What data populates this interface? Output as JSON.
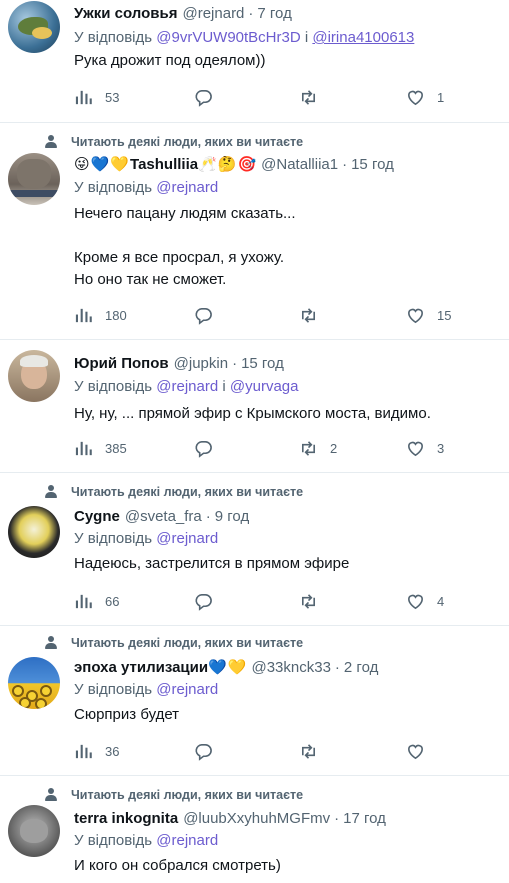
{
  "labels": {
    "replying_to": "У відповідь",
    "and": "і",
    "followed_by_context": "Читають деякі люди, яких ви читаєте"
  },
  "tweets": [
    {
      "name": "Ужки соловья",
      "handle": "@rejnard",
      "time": "7 год",
      "reply_to": [
        "@9vrVUW90tBcHr3D",
        "@irina4100613"
      ],
      "text": "Рука дрожит под одеялом))",
      "views": "53",
      "replies": "",
      "retweets": "",
      "likes": "1"
    },
    {
      "name": "Tashulliia",
      "emoji_before": [
        "😜",
        "💙",
        "💛"
      ],
      "emoji_after": [
        "🥂",
        "🤔",
        "🎯"
      ],
      "handle": "@Natalliia1",
      "time": "15 год",
      "reply_to": [
        "@rejnard"
      ],
      "text": "Нечего  пацану людям сказать...\n\nКроме я все просрал, я ухожу.\nНо оно так не сможет.",
      "views": "180",
      "replies": "",
      "retweets": "",
      "likes": "15"
    },
    {
      "name": "Юрий Попов",
      "handle": "@jupkin",
      "time": "15 год",
      "reply_to": [
        "@rejnard",
        "@yurvaga"
      ],
      "text": "Ну, ну,    ... прямой эфир с Крымского моста, видимо.",
      "views": "385",
      "replies": "",
      "retweets": "2",
      "likes": "3"
    },
    {
      "name": "Cygne",
      "handle": "@sveta_fra",
      "time": "9 год",
      "reply_to": [
        "@rejnard"
      ],
      "text": "Надеюсь, застрелится в прямом эфире",
      "views": "66",
      "replies": "",
      "retweets": "",
      "likes": "4"
    },
    {
      "name": "эпоха утилизации",
      "emoji_after": [
        "💙",
        "💛"
      ],
      "handle": "@33knck33",
      "time": "2 год",
      "reply_to": [
        "@rejnard"
      ],
      "text": "Сюрприз будет",
      "views": "36",
      "replies": "",
      "retweets": "",
      "likes": ""
    },
    {
      "name": "terra inkognita",
      "handle": "@luubXxyhuhMGFmv",
      "time": "17 год",
      "reply_to": [
        "@rejnard"
      ],
      "text": "И кого он собрался смотреть)"
    }
  ]
}
